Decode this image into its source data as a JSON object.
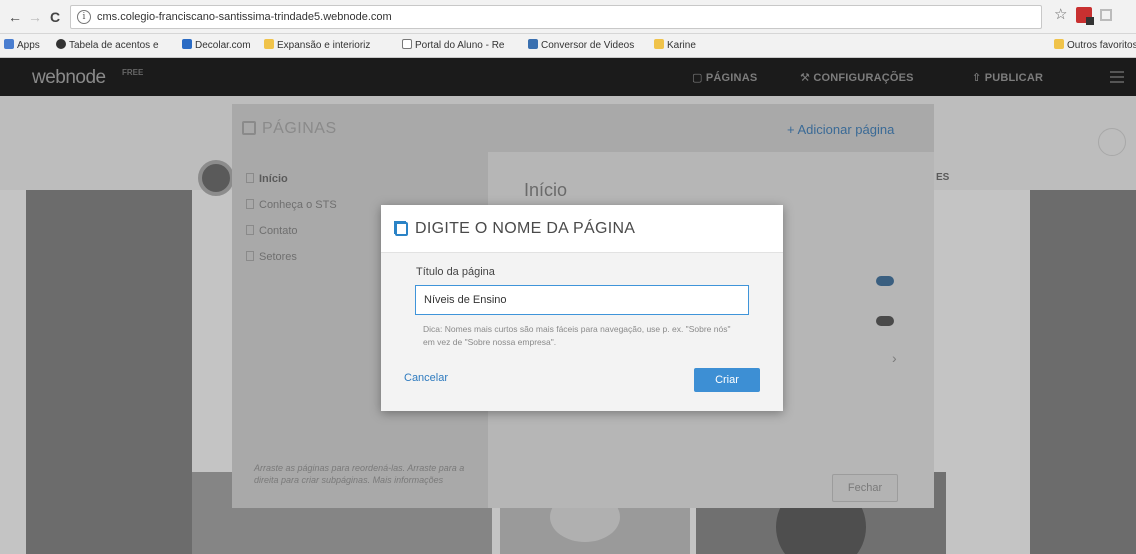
{
  "browser": {
    "url": "cms.colegio-franciscano-santissima-trindade5.webnode.com",
    "bookmarks": [
      {
        "label": "Apps"
      },
      {
        "label": "Tabela de acentos e"
      },
      {
        "label": "Decolar.com"
      },
      {
        "label": "Expansão e interioriz"
      },
      {
        "label": "Portal do Aluno - Re"
      },
      {
        "label": "Conversor de Videos"
      },
      {
        "label": "Karine"
      }
    ],
    "other_bookmarks": "Outros favoritos"
  },
  "webnode_bar": {
    "logo": "webnode",
    "badge": "FREE",
    "menu": {
      "pages": "PÁGINAS",
      "settings": "CONFIGURAÇÕES",
      "publish": "PUBLICAR"
    }
  },
  "pages_panel": {
    "title": "PÁGINAS",
    "add_page": "+ Adicionar página",
    "items": [
      {
        "label": "Início"
      },
      {
        "label": "Conheça o STS"
      },
      {
        "label": "Contato"
      },
      {
        "label": "Setores"
      }
    ],
    "detail_title": "Início",
    "close": "Fechar",
    "hint": "Arraste as páginas para reordená-las. Arraste para a direita para criar subpáginas. Mais informações"
  },
  "background": {
    "corner_text": "ES"
  },
  "modal": {
    "title": "DIGITE O NOME DA PÁGINA",
    "field_label": "Título da página",
    "input_value": "Níveis de Ensino",
    "hint": "Dica: Nomes mais curtos são mais fáceis para navegação, use p. ex. \"Sobre nós\" em vez de \"Sobre nossa empresa\".",
    "cancel": "Cancelar",
    "create": "Criar"
  },
  "colors": {
    "accent": "#3d8fd4",
    "toolbar": "#1b1b1b"
  }
}
